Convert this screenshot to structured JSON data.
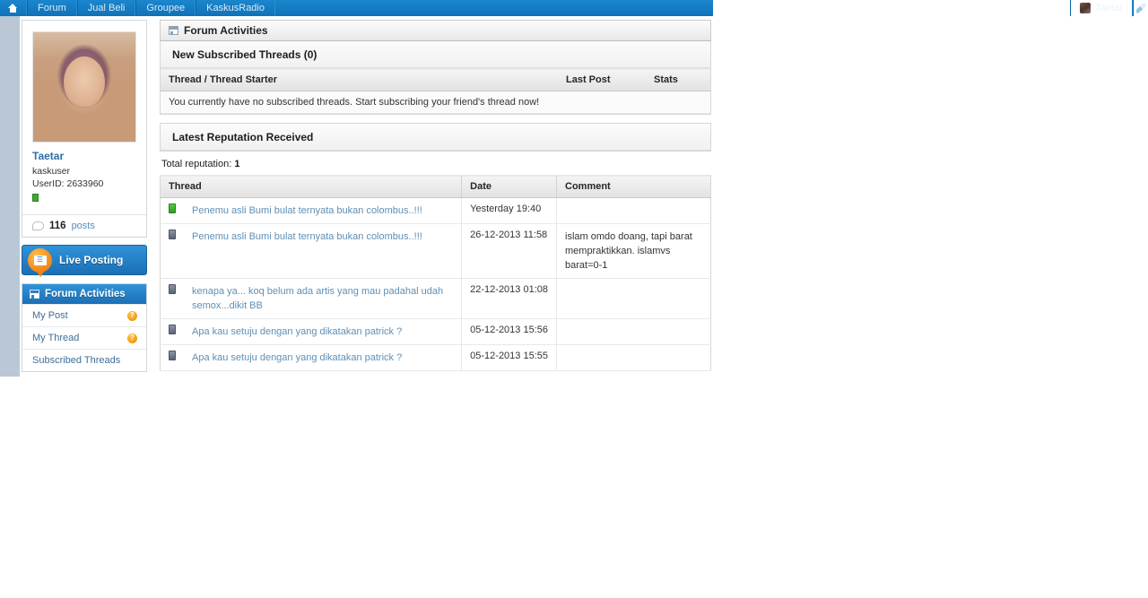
{
  "topnav": {
    "home_icon": "home-icon",
    "items": [
      {
        "label": "Forum"
      },
      {
        "label": "Jual Beli"
      },
      {
        "label": "Groupee"
      },
      {
        "label": "KaskusRadio"
      }
    ],
    "user": {
      "name": "Taetar",
      "avatar_icon": "user-avatar"
    },
    "edit_icon": "pencil-icon",
    "accent_color": "#1378bd"
  },
  "sidebar": {
    "avatar_alt": "profile-photo",
    "profile": {
      "name": "Taetar",
      "usergroup": "kaskuser",
      "userid": "UserID: 2633960",
      "status_color": "#3ea832",
      "posts_count": "116",
      "posts_label": "posts"
    },
    "live_posting": {
      "label": "Live Posting",
      "icon": "live-posting-icon"
    },
    "activities": {
      "header": "Forum Activities",
      "header_icon": "panel-icon",
      "items": [
        {
          "label": "My Post",
          "badge": "?"
        },
        {
          "label": "My Thread",
          "badge": "?"
        },
        {
          "label": "Subscribed Threads",
          "badge": ""
        }
      ]
    }
  },
  "main": {
    "header": {
      "title": "Forum Activities",
      "icon": "panel-icon"
    },
    "subscribed": {
      "title": "New Subscribed Threads (0)",
      "columns": [
        "Thread / Thread Starter",
        "Last Post",
        "Stats"
      ],
      "empty_message": "You currently have no subscribed threads. Start subscribing your friend's thread now!"
    },
    "reputation": {
      "title": "Latest Reputation Received",
      "total_label": "Total reputation:",
      "total_value": "1",
      "columns": [
        "Thread",
        "Date",
        "Comment"
      ],
      "rows": [
        {
          "rep_type": "green",
          "thread": "Penemu asli Bumi bulat ternyata bukan colombus..!!!",
          "date": "Yesterday 19:40",
          "comment": ""
        },
        {
          "rep_type": "gray",
          "thread": "Penemu asli Bumi bulat ternyata bukan colombus..!!!",
          "date": "26-12-2013 11:58",
          "comment": "islam omdo doang, tapi barat mempraktikkan. islamvs barat=0-1"
        },
        {
          "rep_type": "gray",
          "thread": "kenapa ya... koq belum ada artis yang mau padahal udah semox...dikit BB",
          "date": "22-12-2013 01:08",
          "comment": ""
        },
        {
          "rep_type": "gray",
          "thread": "Apa kau setuju dengan yang dikatakan patrick ?",
          "date": "05-12-2013 15:56",
          "comment": ""
        },
        {
          "rep_type": "gray",
          "thread": "Apa kau setuju dengan yang dikatakan patrick ?",
          "date": "05-12-2013 15:55",
          "comment": ""
        }
      ]
    }
  }
}
